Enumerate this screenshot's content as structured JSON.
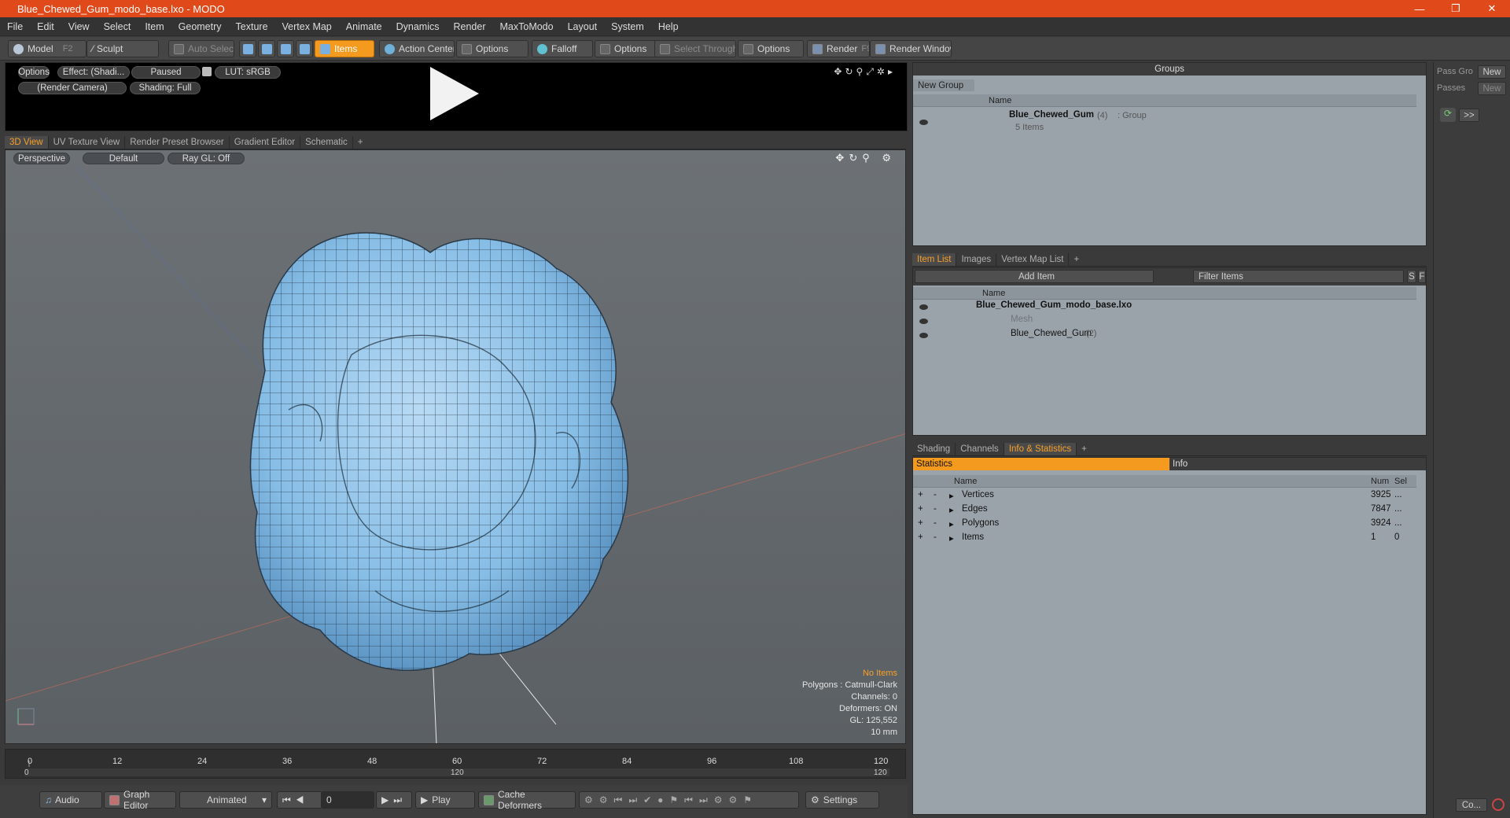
{
  "window": {
    "title": "Blue_Chewed_Gum_modo_base.lxo - MODO",
    "controls": [
      "—",
      "❐",
      "✕"
    ]
  },
  "menu": [
    "File",
    "Edit",
    "View",
    "Select",
    "Item",
    "Geometry",
    "Texture",
    "Vertex Map",
    "Animate",
    "Dynamics",
    "Render",
    "MaxToModo",
    "Layout",
    "System",
    "Help"
  ],
  "toolbar": {
    "model": "Model",
    "model_key": "F2",
    "sculpt": "Sculpt",
    "auto_select": "Auto Select",
    "items": "Items",
    "action_center": "Action Center",
    "options1": "Options",
    "falloff": "Falloff",
    "options2": "Options",
    "select_through": "Select Through",
    "options3": "Options",
    "render": "Render",
    "render_key": "F9",
    "render_window": "Render Window"
  },
  "preview": {
    "options": "Options",
    "effect": "Effect: (Shadi...",
    "paused": "Paused",
    "lut": "LUT: sRGB",
    "camera": "(Render Camera)",
    "shading": "Shading: Full"
  },
  "viewtabs": {
    "tabs": [
      "3D View",
      "UV Texture View",
      "Render Preset Browser",
      "Gradient Editor",
      "Schematic"
    ],
    "add": "+"
  },
  "viewport": {
    "perspective": "Perspective",
    "default": "Default",
    "raygl": "Ray GL: Off",
    "info": {
      "no_items": "No Items",
      "polygons": "Polygons : Catmull-Clark",
      "channels": "Channels: 0",
      "deformers": "Deformers: ON",
      "gl": "GL: 125,552",
      "unit": "10 mm"
    }
  },
  "timeline": {
    "ticks": [
      "0",
      "12",
      "24",
      "36",
      "48",
      "60",
      "72",
      "84",
      "96",
      "108",
      "120"
    ],
    "range_start": "0",
    "range_mid": "120",
    "range_end": "120"
  },
  "bottombar": {
    "audio": "Audio",
    "graph_editor": "Graph Editor",
    "animated": "Animated",
    "frame": "0",
    "play": "Play",
    "cache_deformers": "Cache Deformers",
    "settings": "Settings"
  },
  "groups": {
    "title": "Groups",
    "new_group": "New Group",
    "col_name": "Name",
    "item_name": "Blue_Chewed_Gum",
    "item_count": "(4)",
    "item_type": ": Group",
    "item_sub": "5 Items"
  },
  "passes": {
    "pass_groups": "Pass Gro",
    "new1": "New",
    "passes": "Passes",
    "new2": "New",
    "more": ">>",
    "co": "Co..."
  },
  "itemlist": {
    "tabs": [
      "Item List",
      "Images",
      "Vertex Map List"
    ],
    "add": "+",
    "add_item": "Add Item",
    "filter": "Filter Items",
    "s": "S",
    "f": "F",
    "col_name": "Name",
    "rows": [
      {
        "name": "Blue_Chewed_Gum_modo_base.lxo"
      },
      {
        "name": "Mesh"
      },
      {
        "name": "Blue_Chewed_Gum",
        "count": "(2)"
      }
    ]
  },
  "stats": {
    "tabs": [
      "Shading",
      "Channels",
      "Info & Statistics"
    ],
    "add": "+",
    "statistics": "Statistics",
    "info": "Info",
    "col_name": "Name",
    "col_num": "Num",
    "col_sel": "Sel",
    "rows": [
      {
        "name": "Vertices",
        "num": "3925",
        "sel": "..."
      },
      {
        "name": "Edges",
        "num": "7847",
        "sel": "..."
      },
      {
        "name": "Polygons",
        "num": "3924",
        "sel": "..."
      },
      {
        "name": "Items",
        "num": "1",
        "sel": "0"
      }
    ]
  },
  "colors": {
    "accent": "#f39a1f",
    "titlebar": "#e0491a",
    "mesh": "#8cc0e8"
  }
}
